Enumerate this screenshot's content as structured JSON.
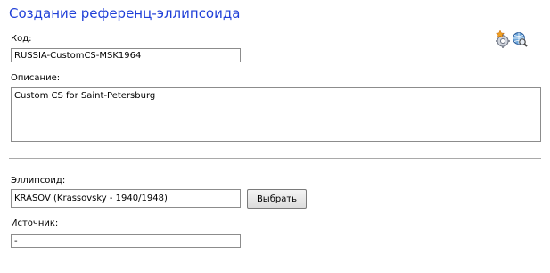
{
  "page": {
    "title": "Создание референц-эллипсоида"
  },
  "toolbar": {
    "icons": [
      "gear-star-icon",
      "globe-search-icon"
    ]
  },
  "form": {
    "code": {
      "label": "Код:",
      "value": "RUSSIA-CustomCS-MSK1964"
    },
    "description": {
      "label": "Описание:",
      "value": "Custom CS for Saint-Petersburg"
    },
    "ellipsoid": {
      "label": "Эллипсоид:",
      "value": "KRASOV (Krassovsky - 1940/1948)",
      "select_label": "Выбрать"
    },
    "source": {
      "label": "Источник:",
      "value": "-"
    }
  }
}
